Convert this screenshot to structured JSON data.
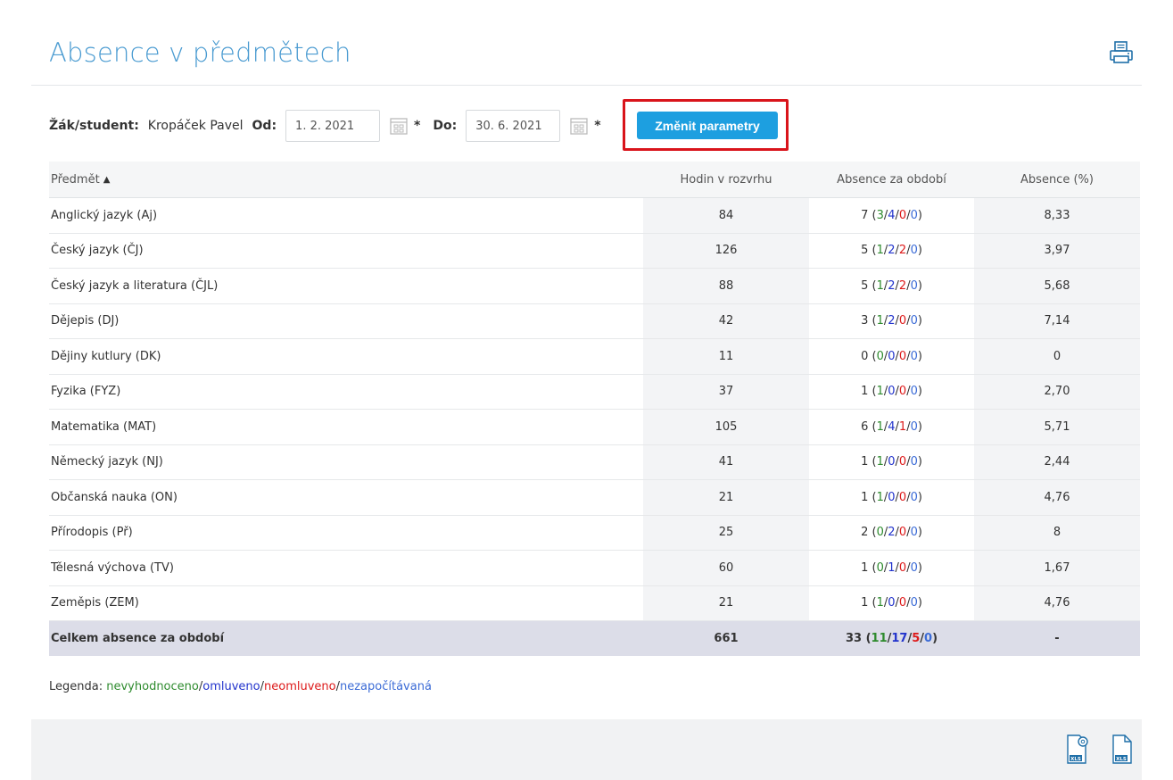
{
  "page_title": "Absence v předmětech",
  "icons": {
    "print": "printer-icon",
    "calendar": "calendar-icon",
    "xls_settings": "xls-settings-icon",
    "xls": "xls-icon"
  },
  "params": {
    "student_label": "Žák/student:",
    "student_name": "Kropáček Pavel",
    "from_label": "Od:",
    "from_value": "1. 2. 2021",
    "to_label": "Do:",
    "to_value": "30. 6. 2021",
    "required_mark": "*",
    "change_button": "Změnit parametry"
  },
  "table": {
    "headers": {
      "subject": "Předmět",
      "hours": "Hodin v rozvrhu",
      "absence": "Absence za období",
      "percent": "Absence (%)"
    },
    "rows": [
      {
        "subject": "Anglický jazyk (Aj)",
        "hours": "84",
        "total": "7",
        "g": "3",
        "b": "4",
        "r": "0",
        "p": "0",
        "percent": "8,33"
      },
      {
        "subject": "Český jazyk (ČJ)",
        "hours": "126",
        "total": "5",
        "g": "1",
        "b": "2",
        "r": "2",
        "p": "0",
        "percent": "3,97"
      },
      {
        "subject": "Český jazyk a literatura (ČJL)",
        "hours": "88",
        "total": "5",
        "g": "1",
        "b": "2",
        "r": "2",
        "p": "0",
        "percent": "5,68"
      },
      {
        "subject": "Dějepis (DJ)",
        "hours": "42",
        "total": "3",
        "g": "1",
        "b": "2",
        "r": "0",
        "p": "0",
        "percent": "7,14"
      },
      {
        "subject": "Dějiny kutlury (DK)",
        "hours": "11",
        "total": "0",
        "g": "0",
        "b": "0",
        "r": "0",
        "p": "0",
        "percent": "0"
      },
      {
        "subject": "Fyzika (FYZ)",
        "hours": "37",
        "total": "1",
        "g": "1",
        "b": "0",
        "r": "0",
        "p": "0",
        "percent": "2,70"
      },
      {
        "subject": "Matematika (MAT)",
        "hours": "105",
        "total": "6",
        "g": "1",
        "b": "4",
        "r": "1",
        "p": "0",
        "percent": "5,71"
      },
      {
        "subject": "Německý jazyk (NJ)",
        "hours": "41",
        "total": "1",
        "g": "1",
        "b": "0",
        "r": "0",
        "p": "0",
        "percent": "2,44"
      },
      {
        "subject": "Občanská nauka (ON)",
        "hours": "21",
        "total": "1",
        "g": "1",
        "b": "0",
        "r": "0",
        "p": "0",
        "percent": "4,76"
      },
      {
        "subject": "Přírodopis (Př)",
        "hours": "25",
        "total": "2",
        "g": "0",
        "b": "2",
        "r": "0",
        "p": "0",
        "percent": "8"
      },
      {
        "subject": "Tělesná výchova (TV)",
        "hours": "60",
        "total": "1",
        "g": "0",
        "b": "1",
        "r": "0",
        "p": "0",
        "percent": "1,67"
      },
      {
        "subject": "Zeměpis (ZEM)",
        "hours": "21",
        "total": "1",
        "g": "1",
        "b": "0",
        "r": "0",
        "p": "0",
        "percent": "4,76"
      }
    ],
    "total_row": {
      "subject": "Celkem absence za období",
      "hours": "661",
      "total": "33",
      "g": "11",
      "b": "17",
      "r": "5",
      "p": "0",
      "percent": "-"
    }
  },
  "legend": {
    "label": "Legenda:",
    "unassessed": "nevyhodnoceno",
    "excused": "omluveno",
    "unexcused": "neomluveno",
    "not_counted": "nezapočítávaná"
  },
  "colors": {
    "accent": "#1d9fe0",
    "title": "#4a9bd1",
    "highlight_border": "#d9141b",
    "green": "#2e8b2e",
    "blue": "#2233cc",
    "red": "#dd1a1a",
    "light_blue": "#3b6bd6"
  }
}
